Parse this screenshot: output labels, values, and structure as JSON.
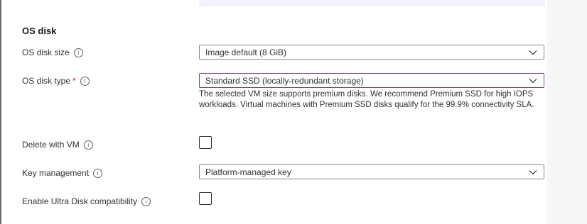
{
  "section": {
    "title": "OS disk"
  },
  "os_disk_size": {
    "label": "OS disk size",
    "value": "Image default (8 GiB)"
  },
  "os_disk_type": {
    "label": "OS disk type",
    "required_mark": "*",
    "value": "Standard SSD (locally-redundant storage)",
    "help_text": "The selected VM size supports premium disks. We recommend Premium SSD for high IOPS workloads. Virtual machines with Premium SSD disks qualify for the 99.9% connectivity SLA."
  },
  "delete_with_vm": {
    "label": "Delete with VM",
    "checked": false
  },
  "key_management": {
    "label": "Key management",
    "value": "Platform-managed key"
  },
  "ultra_disk": {
    "label": "Enable Ultra Disk compatibility",
    "checked": false
  },
  "info_glyph": "i",
  "colors": {
    "focus_border": "#7a3e8f",
    "required": "#a4262c",
    "border": "#8a8886"
  }
}
